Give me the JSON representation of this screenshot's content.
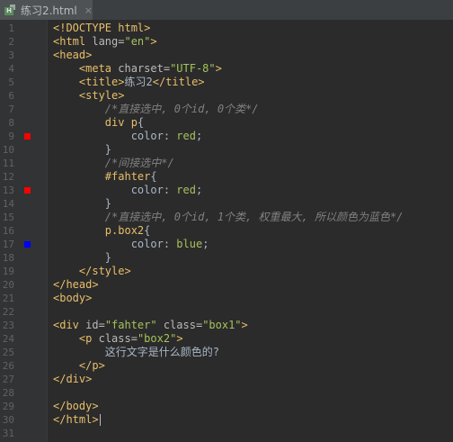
{
  "tab": {
    "filename": "练习2.html",
    "close": "×"
  },
  "colors": {
    "marker_red": "#ff0000",
    "marker_blue": "#0000ff"
  },
  "lines": [
    {
      "n": "1",
      "parts": [
        [
          "tag",
          "<!DOCTYPE html>"
        ]
      ]
    },
    {
      "n": "2",
      "parts": [
        [
          "tag",
          "<html "
        ],
        [
          "attr",
          "lang="
        ],
        [
          "str",
          "\"en\""
        ],
        [
          "tag",
          ">"
        ]
      ]
    },
    {
      "n": "3",
      "parts": [
        [
          "tag",
          "<head>"
        ]
      ]
    },
    {
      "n": "4",
      "parts": [
        [
          "txt",
          "    "
        ],
        [
          "tag",
          "<meta "
        ],
        [
          "attr",
          "charset="
        ],
        [
          "str",
          "\"UTF-8\""
        ],
        [
          "tag",
          ">"
        ]
      ]
    },
    {
      "n": "5",
      "parts": [
        [
          "txt",
          "    "
        ],
        [
          "tag",
          "<title>"
        ],
        [
          "txt",
          "练习2"
        ],
        [
          "tag",
          "</title>"
        ]
      ]
    },
    {
      "n": "6",
      "parts": [
        [
          "txt",
          "    "
        ],
        [
          "tag",
          "<style>"
        ]
      ]
    },
    {
      "n": "7",
      "parts": [
        [
          "txt",
          "        "
        ],
        [
          "cmt",
          "/*直接选中, 0个id, 0个类*/"
        ]
      ]
    },
    {
      "n": "8",
      "parts": [
        [
          "txt",
          "        "
        ],
        [
          "sel",
          "div p"
        ],
        [
          "txt",
          "{"
        ]
      ]
    },
    {
      "n": "9",
      "parts": [
        [
          "txt",
          "            "
        ],
        [
          "prop",
          "color"
        ],
        [
          "txt",
          ": "
        ],
        [
          "val",
          "red"
        ],
        [
          "txt",
          ";"
        ]
      ],
      "marker": "red"
    },
    {
      "n": "10",
      "parts": [
        [
          "txt",
          "        }"
        ]
      ]
    },
    {
      "n": "11",
      "parts": [
        [
          "txt",
          "        "
        ],
        [
          "cmt",
          "/*间接选中*/"
        ]
      ]
    },
    {
      "n": "12",
      "parts": [
        [
          "txt",
          "        "
        ],
        [
          "sel",
          "#fahter"
        ],
        [
          "txt",
          "{"
        ]
      ]
    },
    {
      "n": "13",
      "parts": [
        [
          "txt",
          "            "
        ],
        [
          "prop",
          "color"
        ],
        [
          "txt",
          ": "
        ],
        [
          "val",
          "red"
        ],
        [
          "txt",
          ";"
        ]
      ],
      "marker": "red"
    },
    {
      "n": "14",
      "parts": [
        [
          "txt",
          "        }"
        ]
      ]
    },
    {
      "n": "15",
      "parts": [
        [
          "txt",
          "        "
        ],
        [
          "cmt",
          "/*直接选中, 0个id, 1个类, 权重最大, 所以颜色为蓝色*/"
        ]
      ]
    },
    {
      "n": "16",
      "parts": [
        [
          "txt",
          "        "
        ],
        [
          "sel",
          "p.box2"
        ],
        [
          "txt",
          "{"
        ]
      ]
    },
    {
      "n": "17",
      "parts": [
        [
          "txt",
          "            "
        ],
        [
          "prop",
          "color"
        ],
        [
          "txt",
          ": "
        ],
        [
          "val",
          "blue"
        ],
        [
          "txt",
          ";"
        ]
      ],
      "marker": "blue"
    },
    {
      "n": "18",
      "parts": [
        [
          "txt",
          "        }"
        ]
      ]
    },
    {
      "n": "19",
      "parts": [
        [
          "txt",
          "    "
        ],
        [
          "tag",
          "</style>"
        ]
      ]
    },
    {
      "n": "20",
      "parts": [
        [
          "tag",
          "</head>"
        ]
      ]
    },
    {
      "n": "21",
      "parts": [
        [
          "tag",
          "<body>"
        ]
      ]
    },
    {
      "n": "22",
      "parts": []
    },
    {
      "n": "23",
      "parts": [
        [
          "tag",
          "<div "
        ],
        [
          "attr",
          "id="
        ],
        [
          "str",
          "\"fahter\""
        ],
        [
          "attr",
          " class="
        ],
        [
          "str",
          "\"box1\""
        ],
        [
          "tag",
          ">"
        ]
      ]
    },
    {
      "n": "24",
      "parts": [
        [
          "txt",
          "    "
        ],
        [
          "tag",
          "<p "
        ],
        [
          "attr",
          "class="
        ],
        [
          "str",
          "\"box2\""
        ],
        [
          "tag",
          ">"
        ]
      ]
    },
    {
      "n": "25",
      "parts": [
        [
          "txt",
          "        这行文字是什么颜色的?"
        ]
      ]
    },
    {
      "n": "26",
      "parts": [
        [
          "txt",
          "    "
        ],
        [
          "tag",
          "</p>"
        ]
      ]
    },
    {
      "n": "27",
      "parts": [
        [
          "tag",
          "</div>"
        ]
      ]
    },
    {
      "n": "28",
      "parts": []
    },
    {
      "n": "29",
      "parts": [
        [
          "tag",
          "</body>"
        ]
      ]
    },
    {
      "n": "30",
      "parts": [
        [
          "tag",
          "</html>"
        ]
      ],
      "cursor": true
    },
    {
      "n": "31",
      "parts": []
    }
  ]
}
